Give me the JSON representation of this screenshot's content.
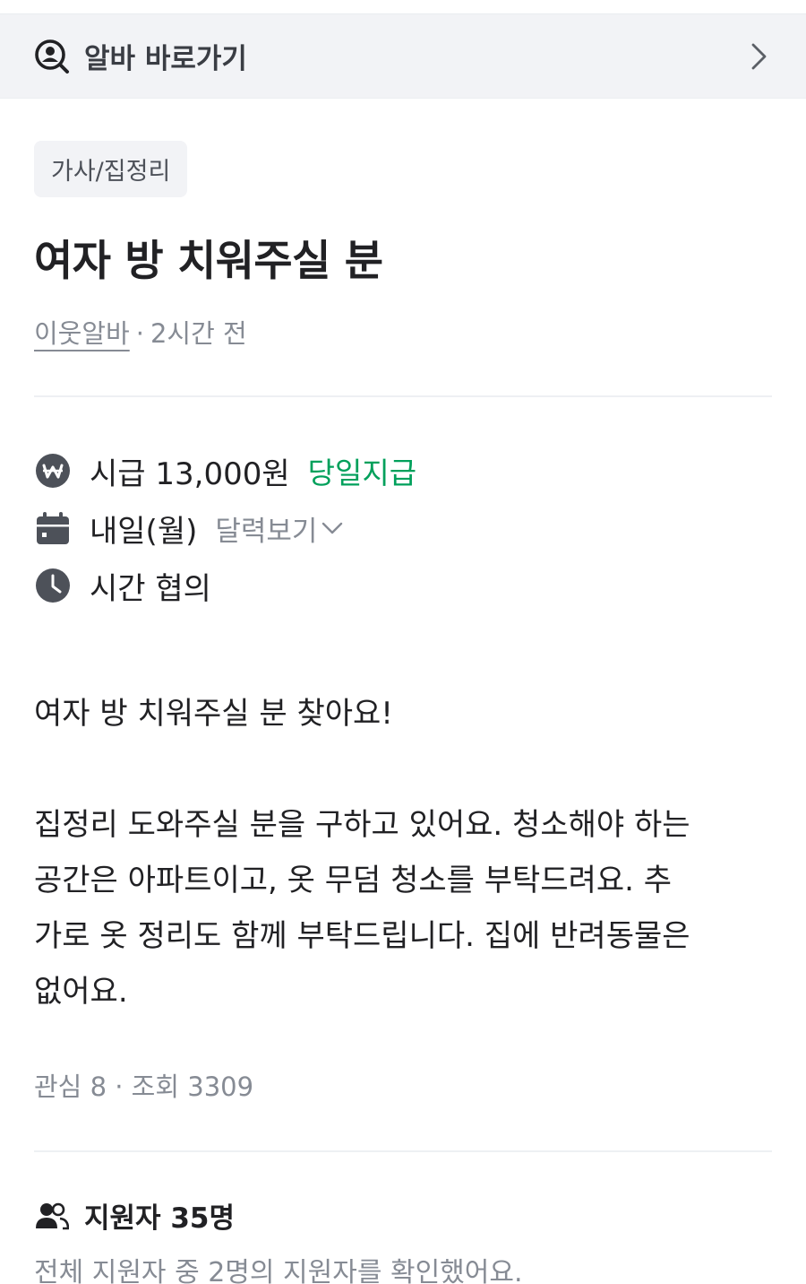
{
  "shortcut": {
    "label": "알바 바로가기",
    "icon": "search-person-icon",
    "chevron": "chevron-right-icon"
  },
  "post": {
    "category": "가사/집정리",
    "title": "여자 방 치워주실 분",
    "author": "이웃알바",
    "separator": "·",
    "time_ago": "2시간 전"
  },
  "info": {
    "wage": "시급 13,000원",
    "pay_type": "당일지급",
    "date": "내일(월)",
    "calendar_link": "달력보기",
    "time": "시간 협의"
  },
  "description": "여자 방 치워주실 분 찾아요!\n\n집정리 도와주실 분을 구하고 있어요. 청소해야 하는\n공간은 아파트이고, 옷 무덤 청소를 부탁드려요. 추\n가로 옷 정리도 함께 부탁드립니다. 집에 반려동물은\n없어요.",
  "stats": "관심 8 · 조회 3309",
  "applicants": {
    "title": "지원자 35명",
    "note": "전체 지원자 중 2명의 지원자를 확인했어요."
  },
  "colors": {
    "accent_green": "#00a05b",
    "icon_gray": "#4d5159",
    "muted": "#868b94"
  }
}
